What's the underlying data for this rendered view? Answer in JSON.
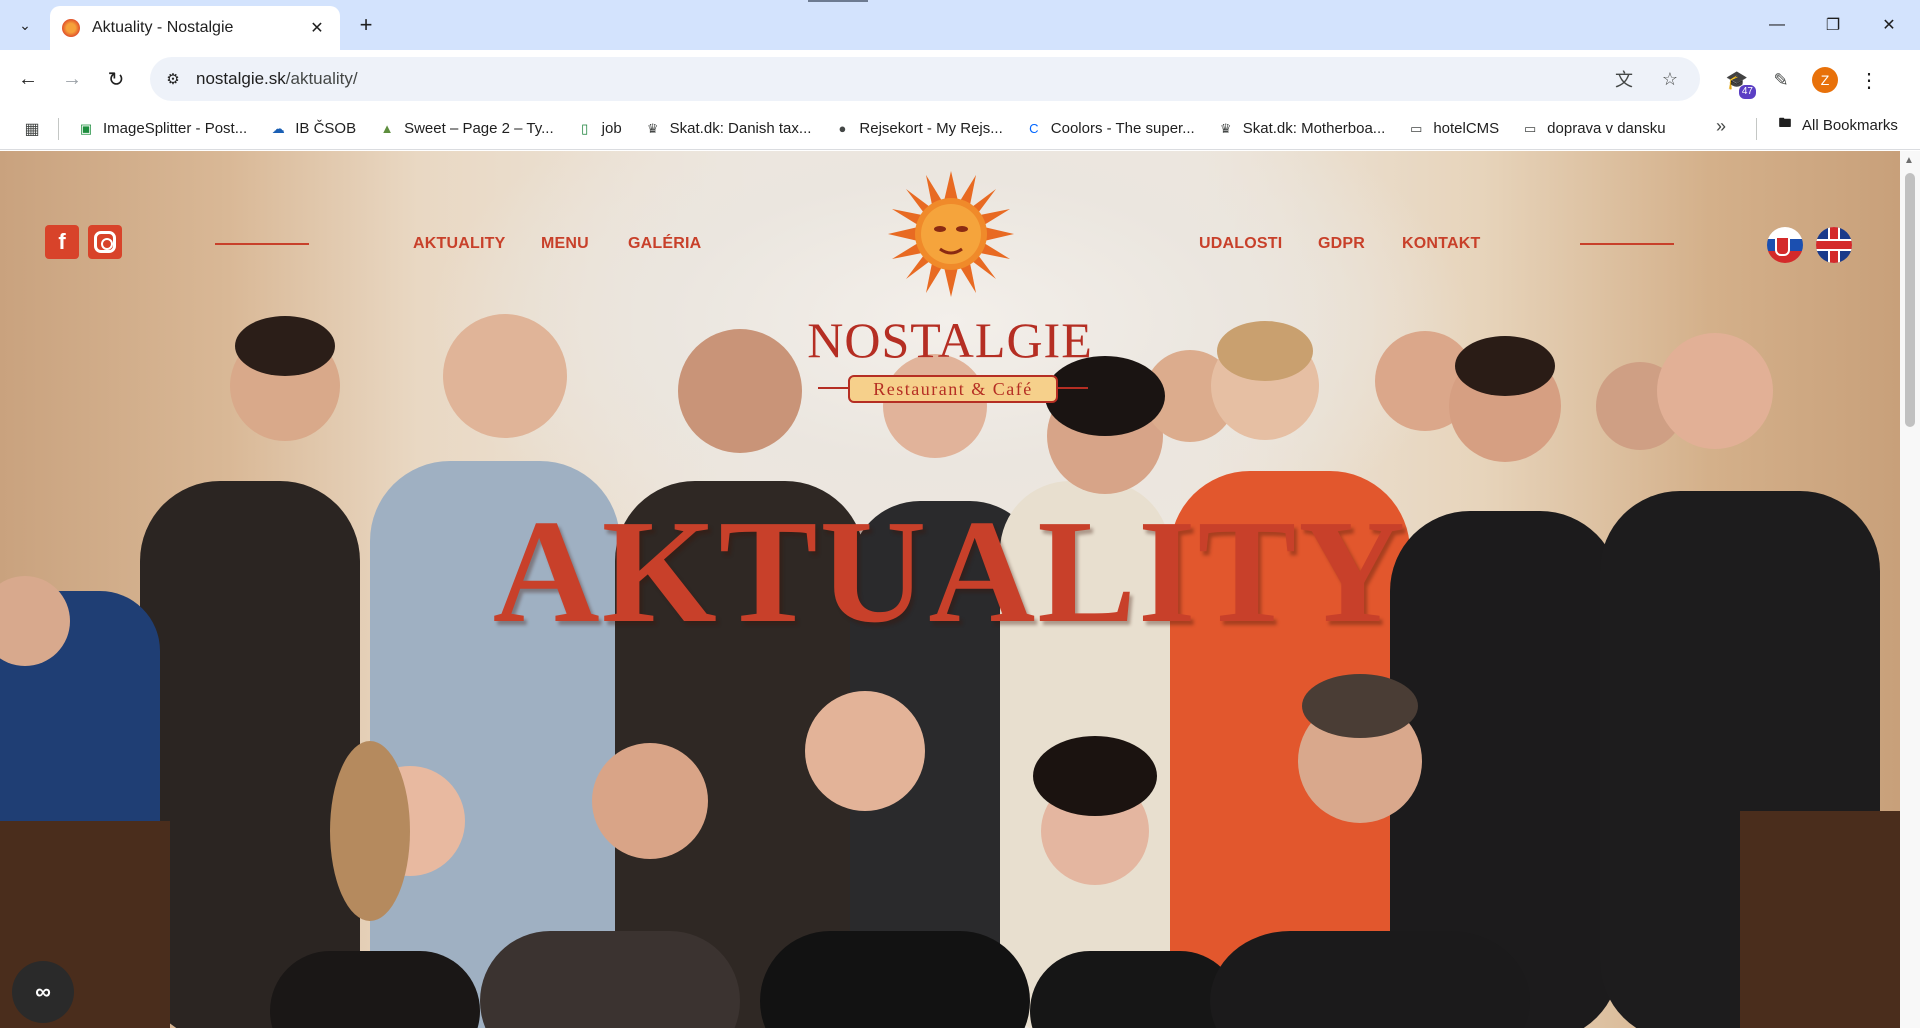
{
  "browser": {
    "tab": {
      "title": "Aktuality - Nostalgie"
    },
    "url": {
      "host": "nostalgie.sk",
      "path": "/aktuality/"
    },
    "extension_badge": "47",
    "profile_initial": "Z",
    "bookmarks": [
      {
        "label": "ImageSplitter - Post...",
        "icon": "imagesplitter-icon",
        "color": "#1e8e3e"
      },
      {
        "label": "IB ČSOB",
        "icon": "csob-icon",
        "color": "#1a5fb4"
      },
      {
        "label": "Sweet – Page 2 – Ty...",
        "icon": "shopify-icon",
        "color": "#5e8e3e"
      },
      {
        "label": "job",
        "icon": "sheets-icon",
        "color": "#188038"
      },
      {
        "label": "Skat.dk: Danish tax...",
        "icon": "crown-icon",
        "color": "#444746"
      },
      {
        "label": "Rejsekort - My Rejs...",
        "icon": "globe-icon",
        "color": "#444746"
      },
      {
        "label": "Coolors - The super...",
        "icon": "coolors-icon",
        "color": "#0066ff"
      },
      {
        "label": "Skat.dk: Motherboa...",
        "icon": "crown-icon",
        "color": "#444746"
      },
      {
        "label": "hotelCMS",
        "icon": "folder-icon",
        "color": "#444746"
      },
      {
        "label": "doprava v dansku",
        "icon": "folder-icon",
        "color": "#444746"
      }
    ],
    "all_bookmarks": "All Bookmarks"
  },
  "site": {
    "nav_left": [
      "AKTUALITY",
      "MENU",
      "GALÉRIA"
    ],
    "nav_right": [
      "UDALOSTI",
      "GDPR",
      "KONTAKT"
    ],
    "logo": {
      "name": "NOSTALGIE",
      "tagline": "Restaurant & Café"
    },
    "hero_title": "AKTUALITY",
    "accent_color": "#c8402a"
  }
}
